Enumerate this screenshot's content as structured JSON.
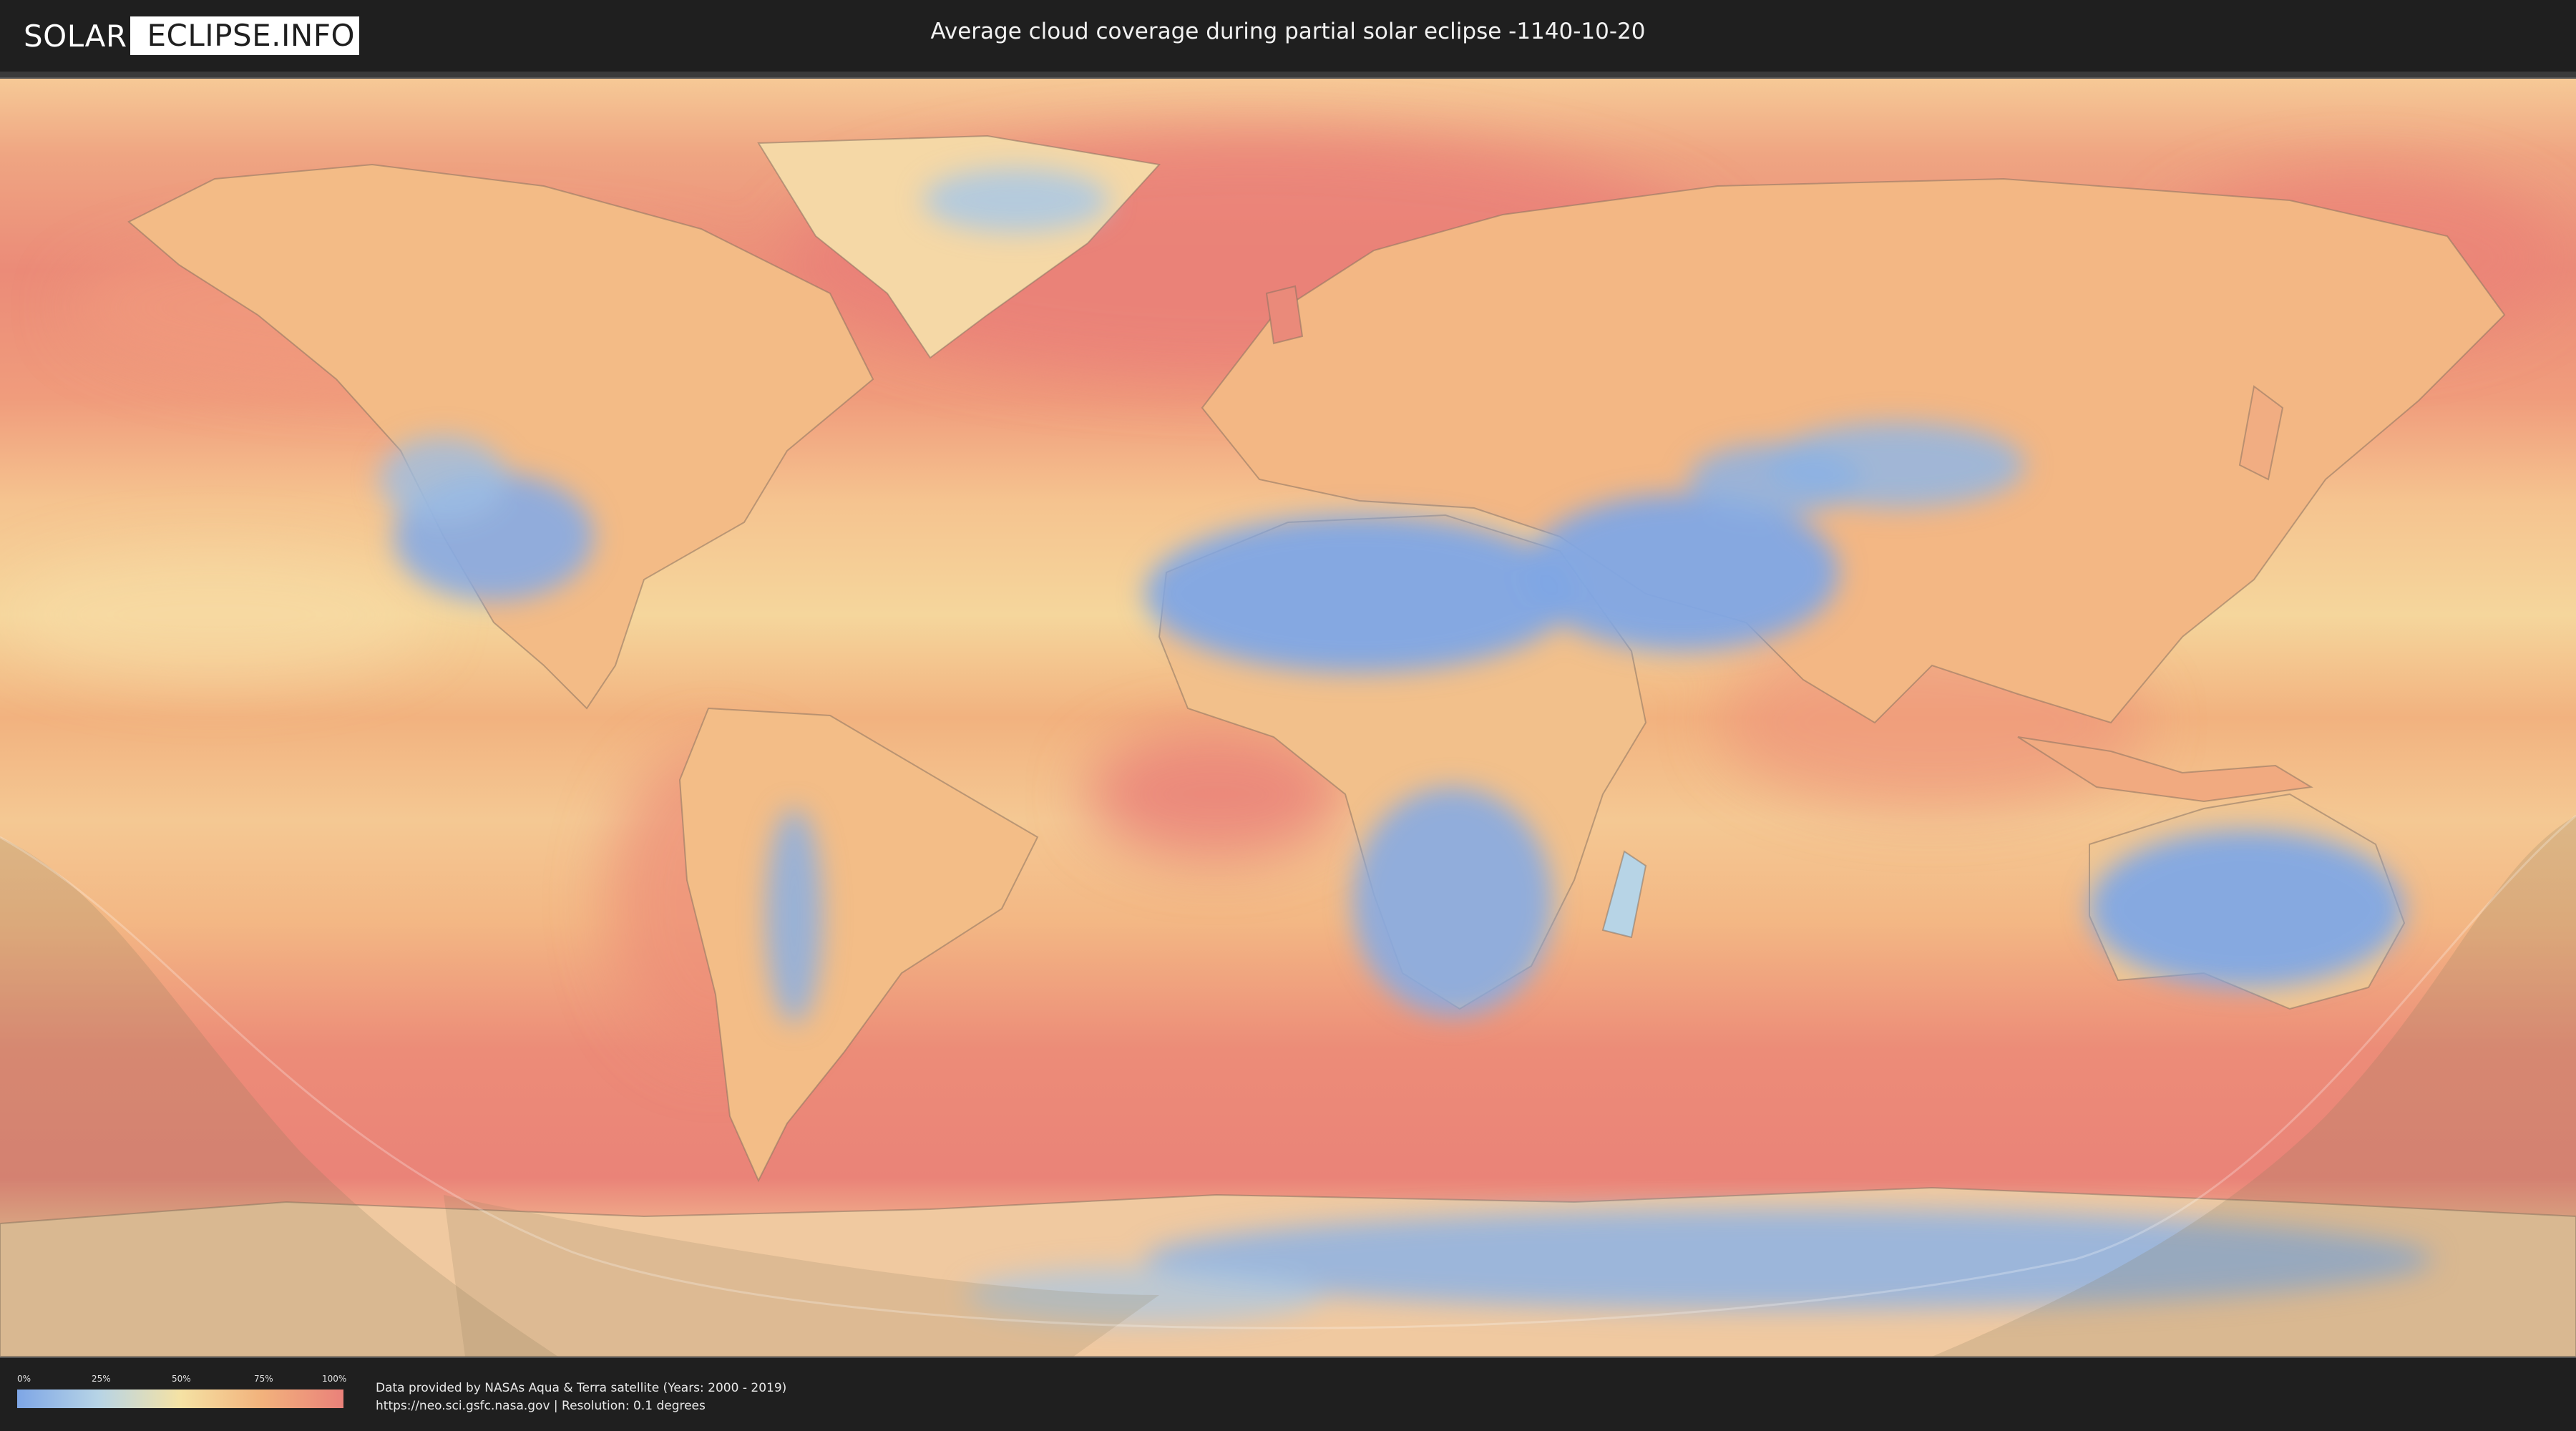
{
  "header": {
    "logo_left": "SOLAR",
    "logo_right": "ECLIPSE.INFO",
    "title": "Average cloud coverage during partial solar eclipse -1140-10-20"
  },
  "legend": {
    "ticks": [
      "0%",
      "25%",
      "50%",
      "75%",
      "100%"
    ],
    "colors": [
      "#7ea6e6",
      "#b7d4e6",
      "#f5e2a4",
      "#f2b27c",
      "#ea817a"
    ]
  },
  "credits": {
    "line1": "Data provided by NASAs Aqua & Terra satellite (Years: 2000 - 2019)",
    "line2": "https://neo.sci.gsfc.nasa.gov | Resolution: 0.1 degrees"
  },
  "map": {
    "layer": "cloud-coverage",
    "overlay": "eclipse-visibility-shadow"
  }
}
